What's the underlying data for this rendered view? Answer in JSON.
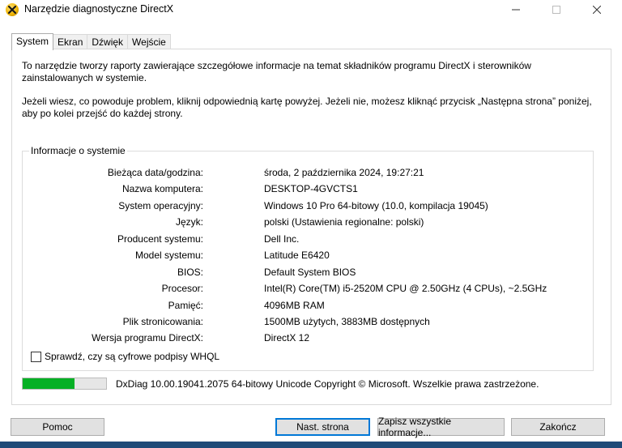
{
  "window": {
    "title": "Narzędzie diagnostyczne DirectX",
    "minimize_symbol": "—",
    "maximize_symbol": "☐",
    "close_symbol": "✕"
  },
  "tabs": [
    {
      "label": "System",
      "active": true
    },
    {
      "label": "Ekran",
      "active": false
    },
    {
      "label": "Dźwięk",
      "active": false
    },
    {
      "label": "Wejście",
      "active": false
    }
  ],
  "intro": {
    "paragraph1": "To narzędzie tworzy raporty zawierające szczegółowe informacje na temat składników programu DirectX i sterowników zainstalowanych w systemie.",
    "paragraph2": "Jeżeli wiesz, co powoduje problem, kliknij odpowiednią kartę powyżej. Jeżeli nie, możesz kliknąć przycisk „Następna strona” poniżej, aby po kolei przejść do każdej strony."
  },
  "system_info": {
    "legend": "Informacje o systemie",
    "rows": [
      {
        "label": "Bieżąca data/godzina:",
        "value": "środa, 2 października 2024, 19:27:21"
      },
      {
        "label": "Nazwa komputera:",
        "value": "DESKTOP-4GVCTS1"
      },
      {
        "label": "System operacyjny:",
        "value": "Windows 10 Pro 64-bitowy (10.0, kompilacja 19045)"
      },
      {
        "label": "Język:",
        "value": "polski (Ustawienia regionalne: polski)"
      },
      {
        "label": "Producent systemu:",
        "value": "Dell Inc."
      },
      {
        "label": "Model systemu:",
        "value": "Latitude E6420"
      },
      {
        "label": "BIOS:",
        "value": "Default System BIOS"
      },
      {
        "label": "Procesor:",
        "value": "Intel(R) Core(TM) i5-2520M CPU @ 2.50GHz (4 CPUs), ~2.5GHz"
      },
      {
        "label": "Pamięć:",
        "value": "4096MB RAM"
      },
      {
        "label": "Plik stronicowania:",
        "value": "1500MB użytych, 3883MB dostępnych"
      },
      {
        "label": "Wersja programu DirectX:",
        "value": "DirectX 12"
      }
    ],
    "whql_checkbox_label": "Sprawdź, czy są cyfrowe podpisy WHQL",
    "whql_checked": false
  },
  "status": {
    "progress_fraction": 0.62,
    "progress_color": "#06b025",
    "footer_text": "DxDiag 10.00.19041.2075 64-bitowy Unicode  Copyright © Microsoft. Wszelkie prawa zastrzeżone."
  },
  "buttons": {
    "help": "Pomoc",
    "next_page": "Nast. strona",
    "save_all": "Zapisz wszystkie informacje...",
    "exit": "Zakończ"
  }
}
